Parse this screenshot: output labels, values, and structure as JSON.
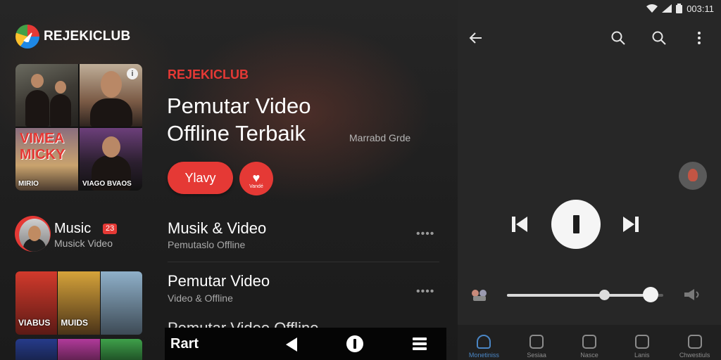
{
  "status_bar": {
    "time": "003:11"
  },
  "app": {
    "name": "REJEKICLUB"
  },
  "featured": {
    "brand": "REJEKICLUB",
    "title": "Pemutar Video Offline Terbaik",
    "subtitle": "Marrabd Grde",
    "play_label": "Ylavy",
    "like_label": "Vandé",
    "art_captions": [
      "VIMEA MICKY",
      "MIRIO",
      "VIAGO BVAOS"
    ]
  },
  "category": {
    "title": "Music",
    "badge": "23",
    "subtitle": "Musick Video"
  },
  "list_items": [
    {
      "title": "Musik & Video",
      "subtitle": "Pemutaslo Offline"
    },
    {
      "title": "Pemutar Video",
      "subtitle": "Video & Offline"
    },
    {
      "title": "Pemutar Video Offline",
      "subtitle": ""
    }
  ],
  "thumb_captions": [
    "VIABUS",
    "MUIDS"
  ],
  "bottom_bar": {
    "label": "Rart"
  },
  "player": {
    "volume_level": 0.92,
    "secondary_level": 0.62
  },
  "nav": {
    "items": [
      {
        "label": "Monetiniss",
        "active": true
      },
      {
        "label": "Sesiaa",
        "active": false
      },
      {
        "label": "Nasce",
        "active": false
      },
      {
        "label": "Lanis",
        "active": false
      },
      {
        "label": "Chwestiuls",
        "active": false
      }
    ]
  },
  "colors": {
    "accent_red": "#e53935",
    "nav_active": "#4a86c5"
  }
}
